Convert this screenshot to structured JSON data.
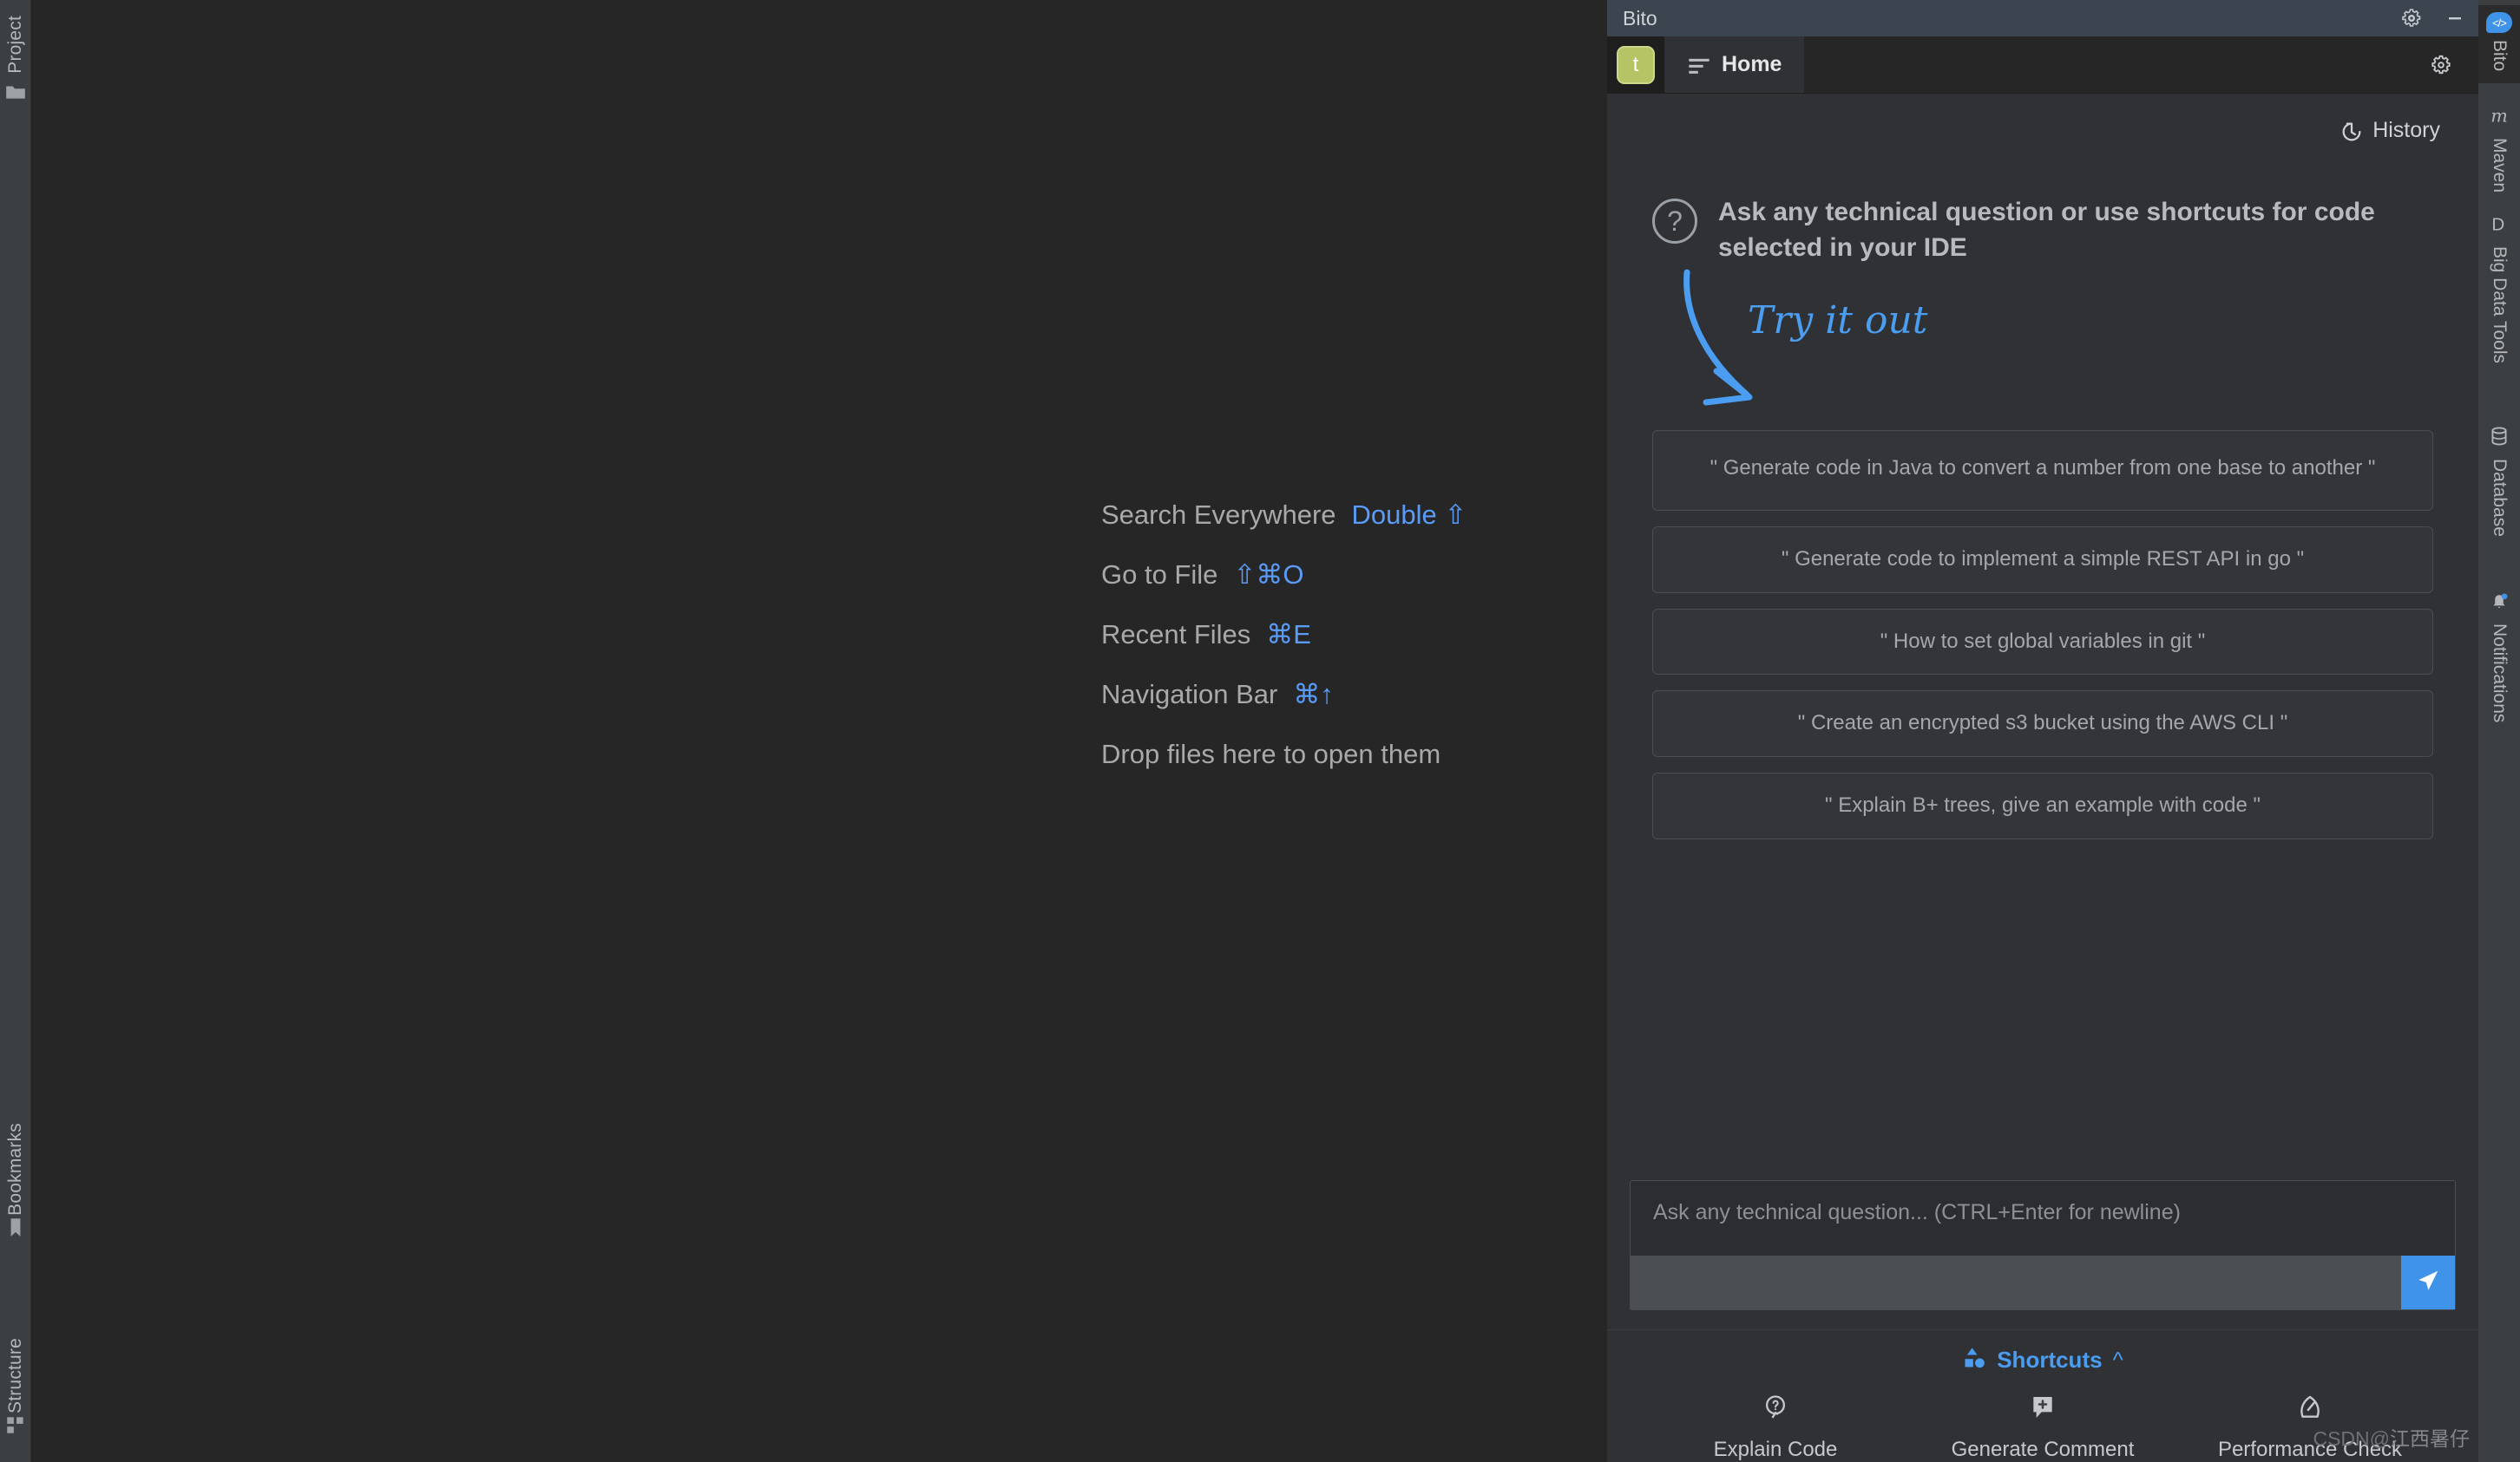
{
  "left_toolbar": {
    "items": [
      {
        "label": "Project",
        "icon": "folder-icon"
      },
      {
        "label": "Bookmarks",
        "icon": "bookmark-icon"
      },
      {
        "label": "Structure",
        "icon": "blocks-icon"
      }
    ]
  },
  "editor": {
    "hints": [
      {
        "label": "Search Everywhere",
        "shortcut": "Double ⇧"
      },
      {
        "label": "Go to File",
        "shortcut": "⇧⌘O"
      },
      {
        "label": "Recent Files",
        "shortcut": "⌘E"
      },
      {
        "label": "Navigation Bar",
        "shortcut": "⌘↑"
      }
    ],
    "drop_hint": "Drop files here to open them"
  },
  "bito": {
    "window_title": "Bito",
    "titlebar_icons": [
      {
        "name": "gear-icon"
      },
      {
        "name": "minimize-icon"
      }
    ],
    "avatar_initial": "t",
    "tab_label": "Home",
    "settings_icon": "gear-icon",
    "history_label": "History",
    "ask_heading": "Ask any technical question or use shortcuts for code selected in your IDE",
    "try_it_out": "Try it out",
    "suggestions": [
      "\" Generate code in Java to convert a number from one base to another \"",
      "\" Generate code to implement a simple REST API in go \"",
      "\" How to set global variables in git \"",
      "\" Create an encrypted s3 bucket using the AWS CLI \"",
      "\" Explain B+ trees, give an example with code \""
    ],
    "input_placeholder": "Ask any technical question... (CTRL+Enter for newline)",
    "send_icon": "send-paper-plane-icon",
    "shortcuts_label": "Shortcuts",
    "shortcut_actions": [
      {
        "label": "Explain Code",
        "icon": "question-bubble-icon"
      },
      {
        "label": "Generate Comment",
        "icon": "comment-plus-icon"
      },
      {
        "label": "Performance Check",
        "icon": "gauge-icon"
      }
    ]
  },
  "right_toolbar": {
    "items": [
      {
        "label": "Bito",
        "icon": "bito-code-badge-icon",
        "active": true
      },
      {
        "label": "Maven",
        "icon": "maven-m-icon",
        "active": false
      },
      {
        "label": "Big Data Tools",
        "icon": "big-data-d-icon",
        "active": false
      },
      {
        "label": "Database",
        "icon": "database-icon",
        "active": false
      },
      {
        "label": "Notifications",
        "icon": "bell-icon",
        "active": false
      }
    ]
  },
  "watermark": {
    "prefix": "CSDN@",
    "name": "江西暑仔"
  },
  "colors": {
    "accent_blue": "#3f93e8",
    "link_blue": "#5b9bf8",
    "avatar_green": "#b6c465",
    "panel_bg": "#2f3134",
    "editor_bg": "#262626",
    "titlebar_bg": "#3c4450"
  }
}
